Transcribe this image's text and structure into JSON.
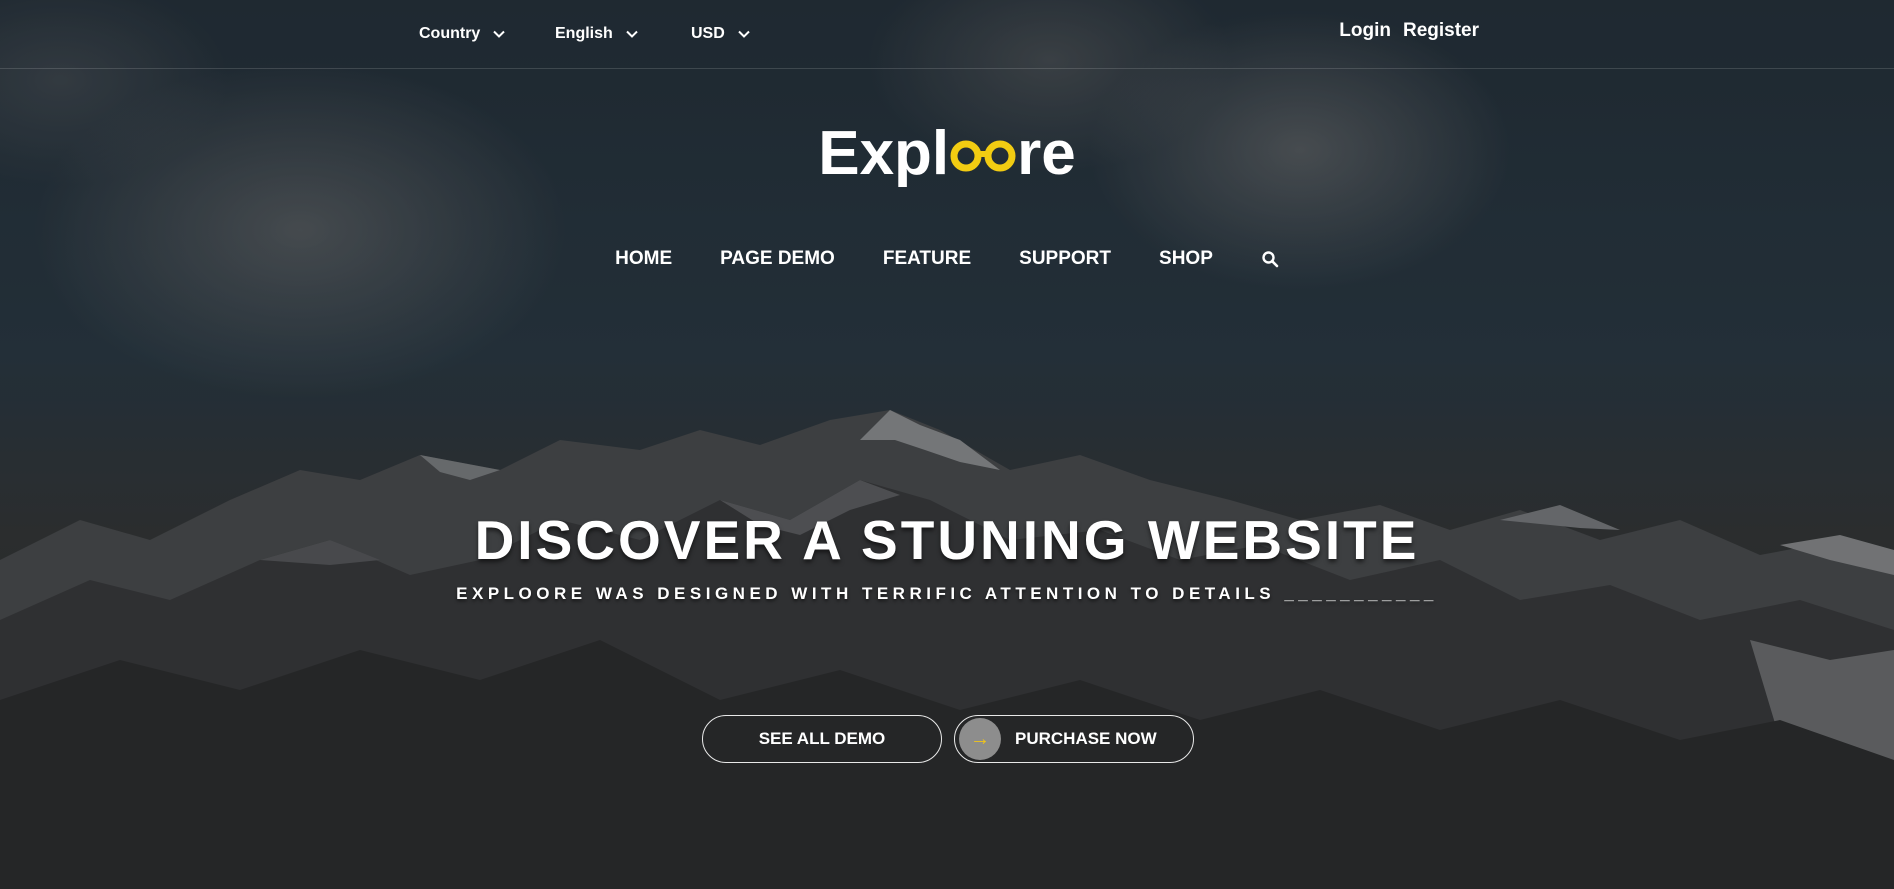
{
  "topbar": {
    "country_label": "Country",
    "language_label": "English",
    "currency_label": "USD",
    "login_label": "Login",
    "register_label": "Register"
  },
  "logo": {
    "prefix": "Expl",
    "suffix": "re",
    "accent_color": "#f2cc12"
  },
  "nav": {
    "items": [
      "HOME",
      "PAGE DEMO",
      "FEATURE",
      "SUPPORT",
      "SHOP"
    ],
    "search_icon": "search-icon"
  },
  "hero": {
    "headline": "DISCOVER A STUNING WEBSITE",
    "subline": "EXPLOORE WAS DESIGNED WITH TERRIFIC ATTENTION TO DETAILS ___________",
    "see_demo_label": "SEE ALL DEMO",
    "purchase_label": "PURCHASE NOW",
    "purchase_arrow": "→"
  },
  "colors": {
    "accent": "#f2cc12",
    "text": "#ffffff",
    "arrow_circle": "#8d8d8d"
  }
}
